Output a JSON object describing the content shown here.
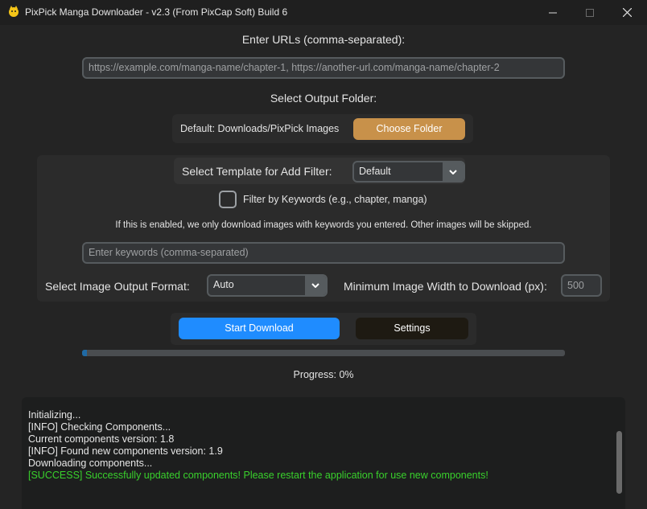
{
  "window": {
    "title": "PixPick Manga Downloader - v2.3 (From PixCap Soft) Build 6"
  },
  "urls": {
    "label": "Enter URLs (comma-separated):",
    "placeholder": "https://example.com/manga-name/chapter-1, https://another-url.com/manga-name/chapter-2"
  },
  "output": {
    "label": "Select Output Folder:",
    "default_text": "Default: Downloads/PixPick Images",
    "choose_button": "Choose Folder"
  },
  "filter": {
    "template_label": "Select Template for Add Filter:",
    "template_value": "Default",
    "keywords_checkbox_label": "Filter by Keywords (e.g., chapter, manga)",
    "keywords_checked": false,
    "info_text": "If this is enabled, we only download images with keywords you entered. Other images will be skipped.",
    "keywords_placeholder": "Enter keywords (comma-separated)",
    "format_label": "Select Image Output Format:",
    "format_value": "Auto",
    "min_width_label": "Minimum Image Width to Download (px):",
    "min_width_placeholder": "500"
  },
  "actions": {
    "start_button": "Start Download",
    "settings_button": "Settings"
  },
  "progress": {
    "value_fraction": 0.01,
    "text": "Progress: 0%"
  },
  "log": {
    "lines": [
      "Initializing...",
      "[INFO] Checking Components...",
      "Current components version: 1.8",
      "[INFO] Found new components version: 1.9",
      "Downloading components...",
      "[SUCCESS] Successfully updated components! Please restart the application for use new components!"
    ]
  },
  "colors": {
    "accent_blue": "#1f8cff",
    "choose_button": "#c8914a",
    "settings_button": "#1e1a12",
    "success_green": "#39d12c"
  }
}
